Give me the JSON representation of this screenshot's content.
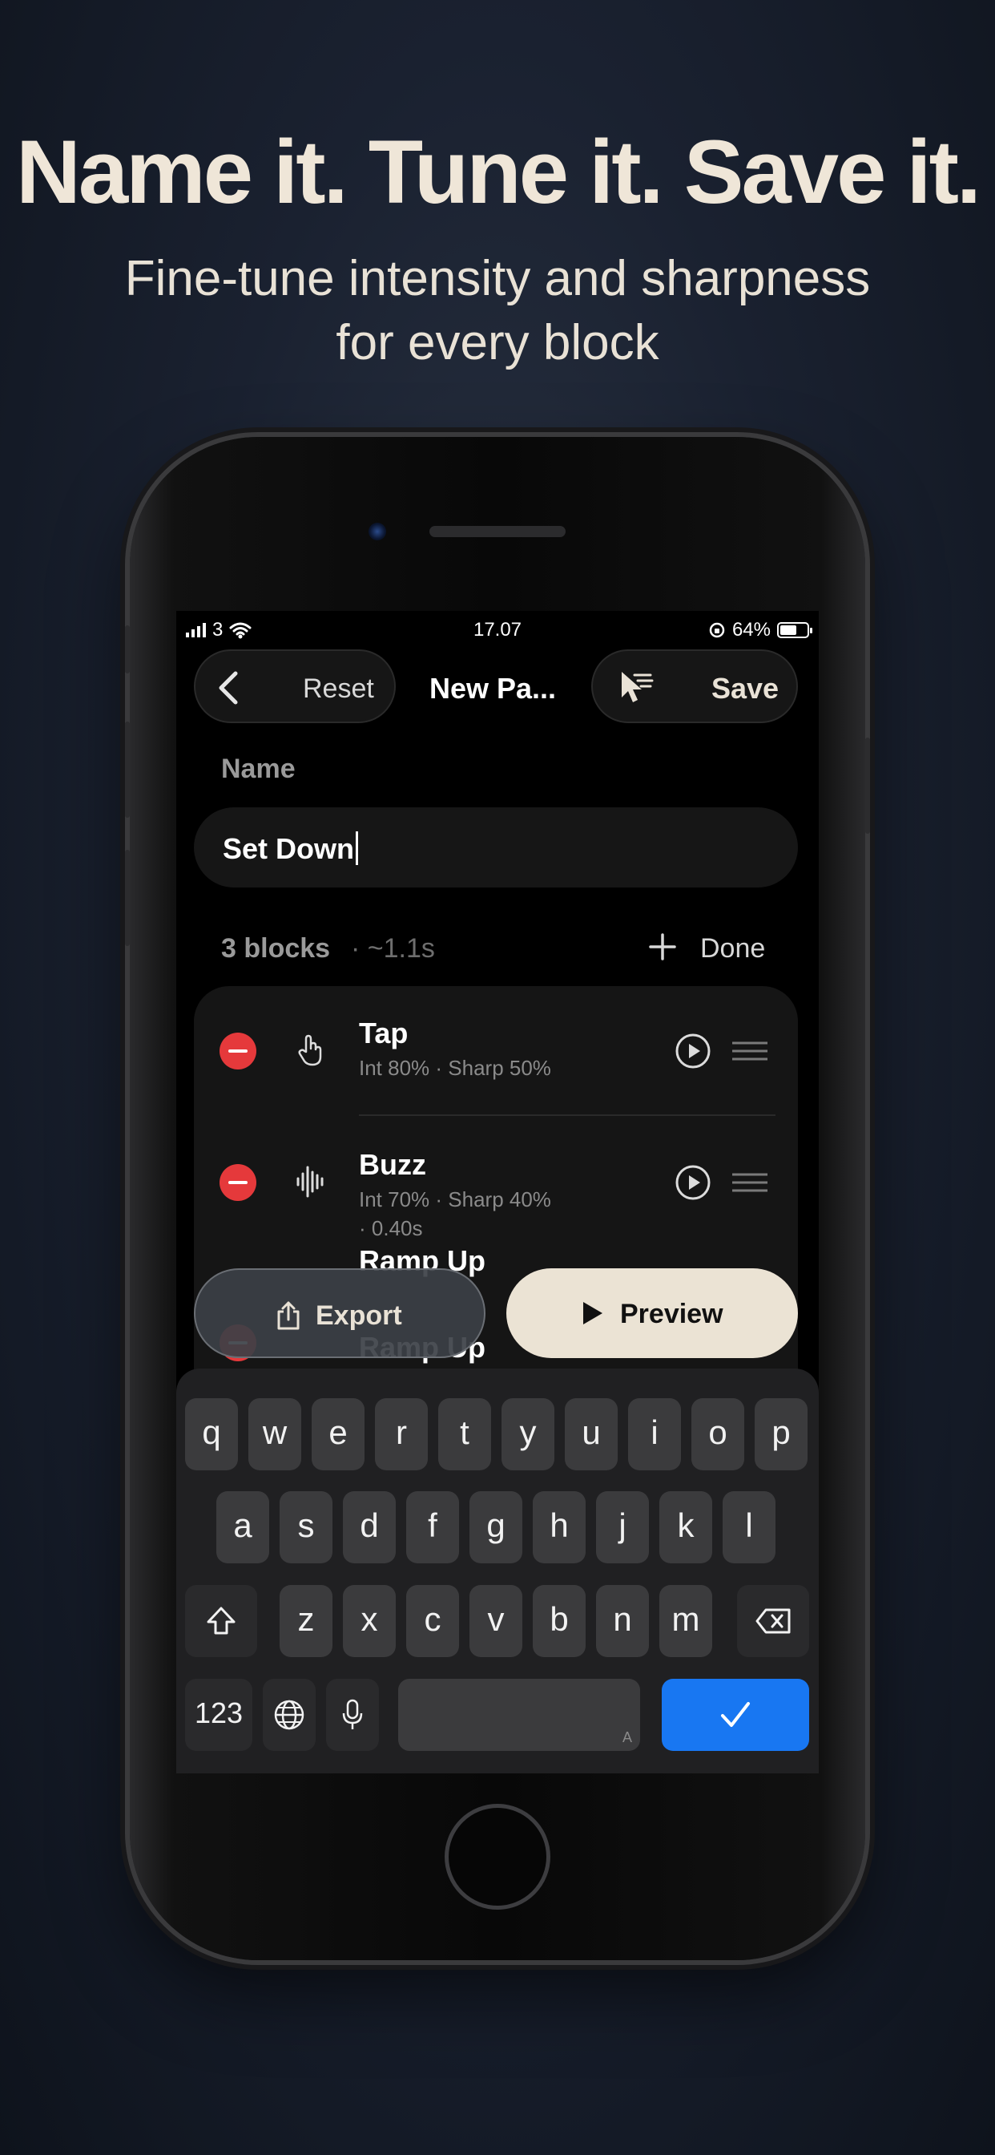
{
  "promo": {
    "headline": "Name it. Tune it. Save it.",
    "subhead_line1": "Fine-tune intensity and sharpness",
    "subhead_line2": "for every block"
  },
  "status_bar": {
    "carrier": "3",
    "time": "17.07",
    "battery": "64%",
    "battery_level": 0.64
  },
  "nav": {
    "reset_label": "Reset",
    "title": "New Pa...",
    "save_label": "Save"
  },
  "name_section": {
    "label": "Name",
    "value": "Set Down"
  },
  "blocks_header": {
    "count": "3 blocks",
    "duration": "· ~1.1s",
    "done_label": "Done"
  },
  "blocks": [
    {
      "title": "Tap",
      "details": "Int 80% · Sharp 50%",
      "icon": "hand-tap-icon"
    },
    {
      "title": "Buzz",
      "details_line1": "Int 70% · Sharp 40%",
      "details_line2": "· 0.40s",
      "icon": "waveform-icon"
    },
    {
      "title": "Ramp Up",
      "icon": "ramp-icon"
    }
  ],
  "actions": {
    "export_label": "Export",
    "preview_label": "Preview"
  },
  "keyboard": {
    "row1": [
      "q",
      "w",
      "e",
      "r",
      "t",
      "y",
      "u",
      "i",
      "o",
      "p"
    ],
    "row2": [
      "a",
      "s",
      "d",
      "f",
      "g",
      "h",
      "j",
      "k",
      "l"
    ],
    "row3": [
      "z",
      "x",
      "c",
      "v",
      "b",
      "n",
      "m"
    ],
    "numbers_label": "123",
    "space_hint": "A",
    "accent_color": "#1877f2"
  }
}
